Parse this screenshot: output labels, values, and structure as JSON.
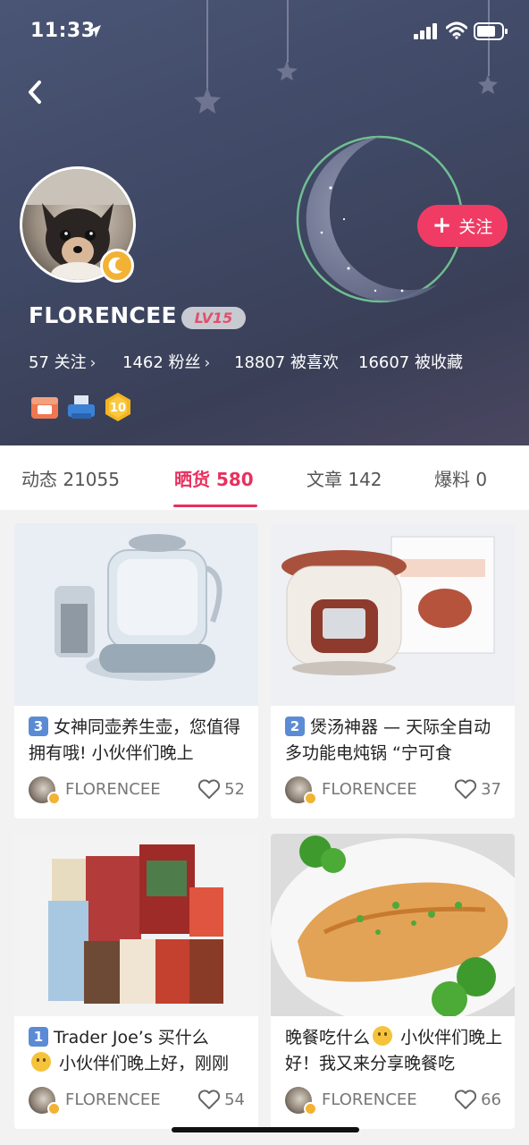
{
  "status_bar": {
    "time": "11:33"
  },
  "profile": {
    "username": "FLORENCEE",
    "level": "LV15",
    "follow_label": "关注",
    "stats": [
      {
        "label": "57 关注",
        "chevron": true
      },
      {
        "label": "1462 粉丝",
        "chevron": true
      },
      {
        "label": "18807 被喜欢",
        "chevron": false
      },
      {
        "label": "16607 被收藏",
        "chevron": false
      }
    ],
    "medals": [
      "camera-medal",
      "printer-medal",
      "level-10-medal"
    ],
    "medal_level_text": "10"
  },
  "tabs": [
    {
      "label": "动态 21055",
      "active": false
    },
    {
      "label": "晒货 580",
      "active": true
    },
    {
      "label": "文章 142",
      "active": false
    },
    {
      "label": "爆料 0",
      "active": false
    }
  ],
  "cards": [
    {
      "badge": "3",
      "title": "女神同壶养生壶，您值得拥有哦! 小伙伴们晚上",
      "author": "FLORENCEE",
      "likes": "52",
      "image": "kettle-photo"
    },
    {
      "badge": "2",
      "title": "煲汤神器 — 天际全自动多功能电炖锅 “宁可食",
      "author": "FLORENCEE",
      "likes": "37",
      "image": "slow-cooker-photo"
    },
    {
      "badge": "1",
      "title": "Trader Joe’s 买什么",
      "title_line2": "小伙伴们晚上好，刚刚",
      "author": "FLORENCEE",
      "likes": "54",
      "image": "snacks-photo"
    },
    {
      "badge": "",
      "title": "晚餐吃什么",
      "title_after_emoji": "小伙伴们晚上好！我又来分享晚餐吃",
      "author": "FLORENCEE",
      "likes": "66",
      "image": "chicken-dish-photo"
    }
  ],
  "colors": {
    "accent": "#e8305e",
    "follow": "#f03c65",
    "badge_blue": "#5b8bd4"
  }
}
